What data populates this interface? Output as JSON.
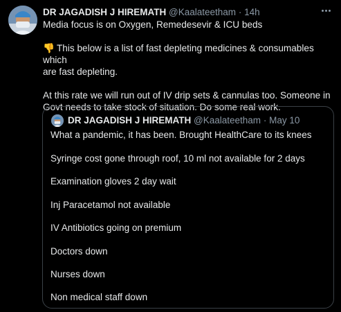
{
  "tweet": {
    "display_name": "DR JAGADISH J HIREMATH",
    "handle": "@Kaalateetham",
    "separator": "·",
    "time": "14h",
    "lines": [
      "Media focus is on Oxygen, Remedesevir & ICU beds",
      "This below is a list of fast depleting medicines & consumables which",
      "are fast depleting.",
      "At this rate we will run out of IV drip sets & cannulas too. Someone in",
      "Govt needs to take stock of situation. Do some real work."
    ],
    "emoji": "👎"
  },
  "quoted": {
    "display_name": "DR JAGADISH J HIREMATH",
    "handle": "@Kaalateetham",
    "separator": "·",
    "date": "May 10",
    "lines": [
      "What a pandemic, it has been. Brought HealthCare to its knees",
      "Syringe cost gone through roof, 10 ml not available for 2 days",
      "Examination gloves 2 day wait",
      "Inj Paracetamol not available",
      "IV Antibiotics going on premium",
      "Doctors down",
      "Nurses down",
      "Non medical staff down"
    ]
  },
  "icons": {
    "avatar": "user-avatar",
    "more": "more-options-icon",
    "emoji": "thumbs-down-emoji"
  },
  "colors": {
    "background": "#000000",
    "text": "#e7e9ea",
    "secondary": "#8b98a5",
    "border": "#3b4147"
  }
}
